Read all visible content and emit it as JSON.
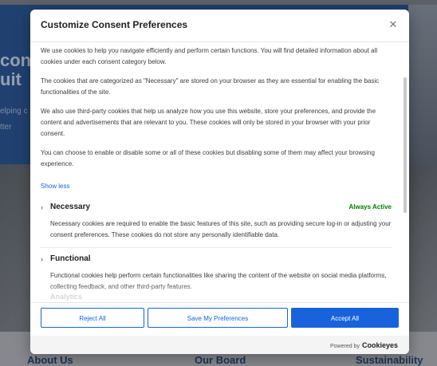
{
  "background": {
    "hero_text": "con\nuit",
    "hero_sub": "elping c\ntter",
    "footer_links": [
      "About Us",
      "Our Board",
      "Sustainability"
    ]
  },
  "modal": {
    "title": "Customize Consent Preferences",
    "close_icon": "close-icon",
    "paragraphs": [
      "We use cookies to help you navigate efficiently and perform certain functions. You will find detailed information about all cookies under each consent category below.",
      "The cookies that are categorized as \"Necessary\" are stored on your browser as they are essential for enabling the basic functionalities of the site.",
      "We also use third-party cookies that help us analyze how you use this website, store your preferences, and provide the content and advertisements that are relevant to you. These cookies will only be stored in your browser with your prior consent.",
      "You can choose to enable or disable some or all of these cookies but disabling some of them may affect your browsing experience."
    ],
    "show_less": "Show less",
    "categories": [
      {
        "name": "Necessary",
        "status": "Always Active",
        "description": "Necessary cookies are required to enable the basic features of this site, such as providing secure log-in or adjusting your consent preferences. These cookies do not store any personally identifiable data."
      },
      {
        "name": "Functional",
        "status": "",
        "description": "Functional cookies help perform certain functionalities like sharing the content of the website on social media platforms, collecting feedback, and other third-party features."
      }
    ],
    "next_category_partial": "Analytics",
    "buttons": {
      "reject": "Reject All",
      "save": "Save My Preferences",
      "accept": "Accept All"
    },
    "powered_by": "Powered by",
    "brand": "Cookieyes",
    "colors": {
      "accent": "#1863dc",
      "always_active": "#008000"
    }
  }
}
